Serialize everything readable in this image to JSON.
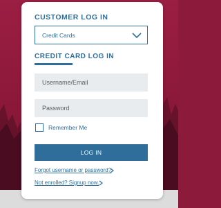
{
  "login": {
    "title": "CUSTOMER LOG IN",
    "account_type": {
      "selected": "Credit Cards"
    },
    "section_title": "CREDIT CARD LOG IN",
    "username_placeholder": "Username/Email",
    "password_placeholder": "Password",
    "remember_me_label": "Remember Me",
    "remember_me_checked": false,
    "login_button": "LOG IN",
    "forgot_link": "Forgot username or password?",
    "signup_link": "Not enrolled? Signup now."
  },
  "colors": {
    "accent": "#2f6e9a",
    "background": "#8c1a3a",
    "field_bg": "#e9ecef"
  }
}
